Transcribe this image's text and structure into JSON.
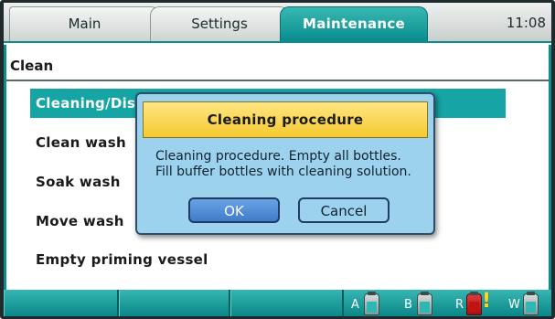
{
  "tabs": {
    "main": "Main",
    "settings": "Settings",
    "maintenance": "Maintenance",
    "active": "Maintenance"
  },
  "clock": "11:08",
  "section": {
    "title": "Clean"
  },
  "menu": {
    "items": [
      {
        "label": "Cleaning/Dis",
        "selected": true
      },
      {
        "label": "Clean wash",
        "selected": false
      },
      {
        "label": "Soak wash",
        "selected": false
      },
      {
        "label": "Move wash",
        "selected": false
      },
      {
        "label": "Empty priming vessel",
        "selected": false
      }
    ]
  },
  "dialog": {
    "title": "Cleaning procedure",
    "line1": "Cleaning procedure. Empty all bottles.",
    "line2": "Fill buffer bottles with cleaning solution.",
    "ok_label": "OK",
    "cancel_label": "Cancel"
  },
  "bottles": [
    {
      "letter": "A",
      "status": "ok"
    },
    {
      "letter": "B",
      "status": "ok"
    },
    {
      "letter": "R",
      "status": "warning",
      "warning_mark": "!"
    },
    {
      "letter": "W",
      "status": "ok"
    }
  ],
  "colors": {
    "accent": "#0c8d8f",
    "selected_row": "#16a4a4",
    "dialog_bg": "#9dd2ee",
    "dialog_header": "#f5c931",
    "ok_button": "#3f7cc9",
    "warning": "#ffd62a",
    "waste_bottle": "#c01414"
  }
}
